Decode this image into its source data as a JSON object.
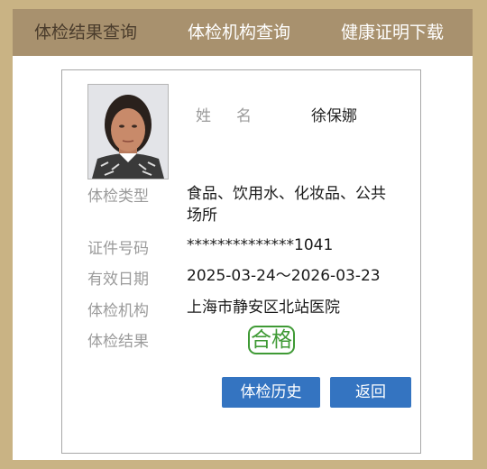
{
  "tabs": [
    {
      "label": "体检结果查询",
      "active": true
    },
    {
      "label": "体检机构查询",
      "active": false
    },
    {
      "label": "健康证明下载",
      "active": false
    }
  ],
  "person": {
    "name_label": "姓名",
    "name": "徐保娜"
  },
  "rows": {
    "type": {
      "label": "体检类型",
      "value": "食品、饮用水、化妆品、公共场所"
    },
    "id": {
      "label": "证件号码",
      "value": "**************1041"
    },
    "date": {
      "label": "有效日期",
      "value": "2025-03-24～2026-03-23"
    },
    "org": {
      "label": "体检机构",
      "value": "上海市静安区北站医院"
    },
    "result": {
      "label": "体检结果",
      "value": "合格"
    }
  },
  "buttons": {
    "history": "体检历史",
    "back": "返回"
  },
  "colors": {
    "page_background": "#c9b384",
    "tab_bar": "#a8916e",
    "button": "#3474c1",
    "stamp": "#3f9a35"
  }
}
